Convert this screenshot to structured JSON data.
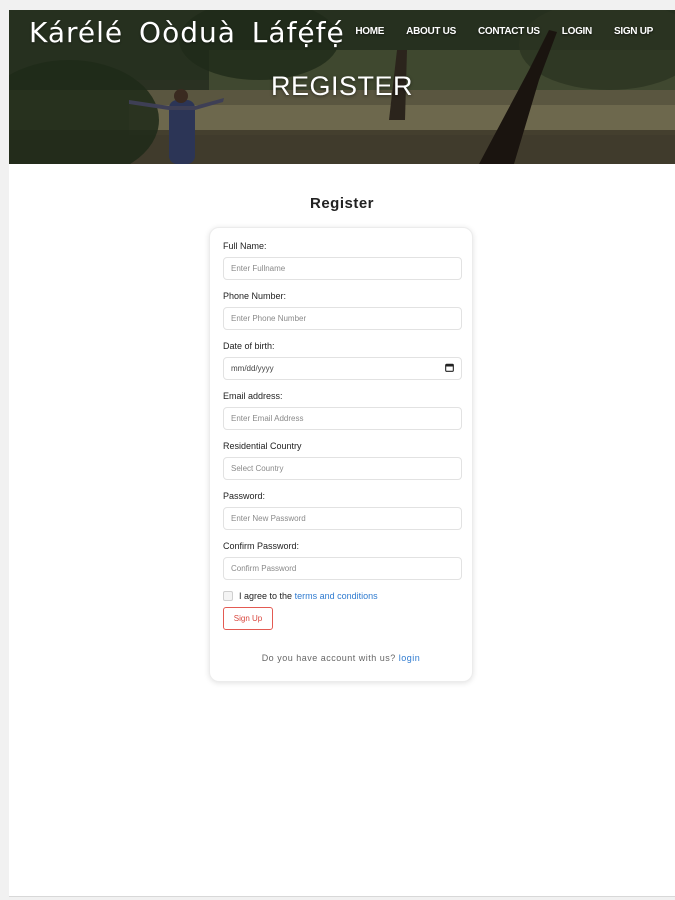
{
  "header": {
    "logo": "Kárélé  Oòduà Láfẹ́fẹ́",
    "hero_title": "REGISTER",
    "nav": [
      {
        "label": "HOME"
      },
      {
        "label": "ABOUT US"
      },
      {
        "label": "CONTACT US"
      },
      {
        "label": "LOGIN"
      },
      {
        "label": "SIGN UP"
      }
    ]
  },
  "form": {
    "title": "Register",
    "fields": {
      "fullname": {
        "label": "Full Name:",
        "placeholder": "Enter Fullname"
      },
      "phone": {
        "label": "Phone Number:",
        "placeholder": "Enter Phone Number"
      },
      "dob": {
        "label": "Date of birth:",
        "value": "mm/dd/yyyy"
      },
      "email": {
        "label": "Email address:",
        "placeholder": "Enter Email Address"
      },
      "country": {
        "label": "Residential Country",
        "placeholder": "Select Country"
      },
      "password": {
        "label": "Password:",
        "placeholder": "Enter New Password"
      },
      "confirm": {
        "label": "Confirm Password:",
        "placeholder": "Confirm Password"
      }
    },
    "terms_prefix": "I agree to the",
    "terms_link": "terms and conditions",
    "signup_label": "Sign Up",
    "account_prompt": "Do you have account with us?",
    "login_link": "login"
  },
  "colors": {
    "link": "#2f7bd0",
    "button_accent": "#d9463d"
  }
}
